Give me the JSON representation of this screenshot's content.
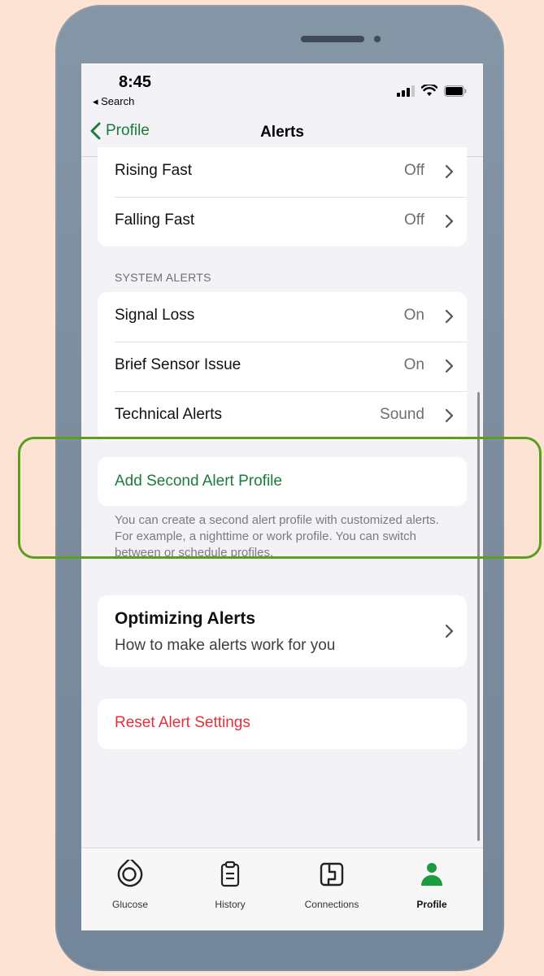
{
  "status_bar": {
    "time": "8:45",
    "back_app": "◂ Search"
  },
  "nav": {
    "back_label": "Profile",
    "title": "Alerts"
  },
  "alert_rows_top": [
    {
      "label": "Rising Fast",
      "value": "Off"
    },
    {
      "label": "Falling Fast",
      "value": "Off"
    }
  ],
  "system_alerts": {
    "header": "SYSTEM ALERTS",
    "rows": [
      {
        "label": "Signal Loss",
        "value": "On"
      },
      {
        "label": "Brief Sensor Issue",
        "value": "On"
      },
      {
        "label": "Technical Alerts",
        "value": "Sound"
      }
    ]
  },
  "second_profile": {
    "button_label": "Add Second Alert Profile",
    "footnote": "You can create a second alert profile with customized alerts. For example, a nighttime or work profile. You can switch between or schedule profiles."
  },
  "optimizing": {
    "title": "Optimizing Alerts",
    "subtitle": "How to make alerts work for you"
  },
  "reset": {
    "label": "Reset Alert Settings"
  },
  "tabs": [
    {
      "label": "Glucose",
      "icon": "glucose-icon"
    },
    {
      "label": "History",
      "icon": "clipboard-icon"
    },
    {
      "label": "Connections",
      "icon": "connections-icon"
    },
    {
      "label": "Profile",
      "icon": "person-icon",
      "active": true
    }
  ],
  "colors": {
    "accent_green": "#1c7c3a",
    "reset_red": "#e0323c",
    "highlight": "#5c9e1d",
    "background": "#fde3d4"
  }
}
